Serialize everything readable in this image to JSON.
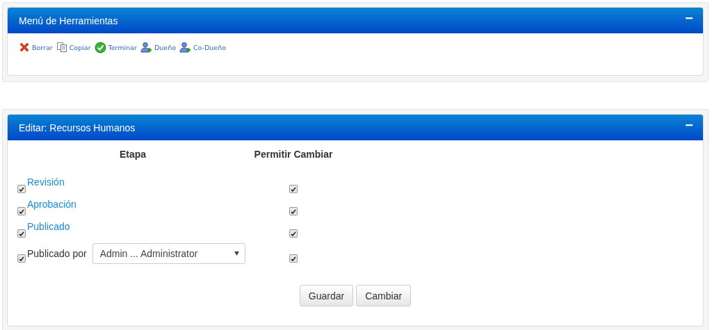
{
  "tools_panel": {
    "title": "Menú de Herramientas",
    "collapse": "−",
    "tools": [
      {
        "kind": "delete",
        "label": "Borrar"
      },
      {
        "kind": "copy",
        "label": "Copiar"
      },
      {
        "kind": "finish",
        "label": "Terminar"
      },
      {
        "kind": "user-add",
        "label": "Dueño"
      },
      {
        "kind": "user-add",
        "label": "Co-Dueño"
      }
    ]
  },
  "edit_panel": {
    "title": "Editar: Recursos Humanos",
    "collapse": "−",
    "columns": [
      "Etapa",
      "Permitir Cambiar"
    ],
    "rows": [
      {
        "kind": "link",
        "checked": true,
        "label": "Revisión",
        "allow_change": true
      },
      {
        "kind": "link",
        "checked": true,
        "label": "Aprobación",
        "allow_change": true
      },
      {
        "kind": "link",
        "checked": true,
        "label": "Publicado",
        "allow_change": true
      },
      {
        "kind": "select",
        "checked": true,
        "label": "Publicado por",
        "value": "Admin ... Administrator",
        "allow_change": true
      }
    ],
    "buttons": [
      "Guardar",
      "Cambiar"
    ]
  }
}
